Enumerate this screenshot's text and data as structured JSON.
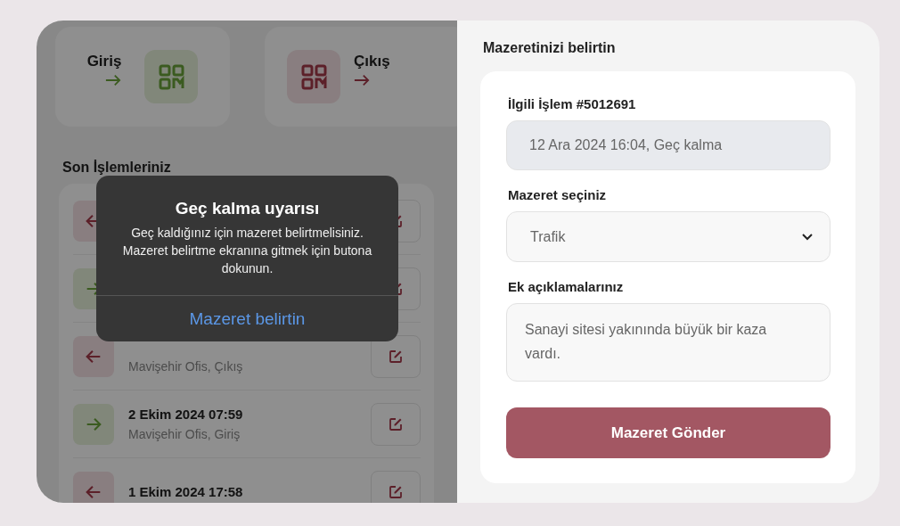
{
  "entry_cards": [
    {
      "label": "Giriş",
      "kind": "in"
    },
    {
      "label": "Çıkış",
      "kind": "out"
    }
  ],
  "recent": {
    "title": "Son İşlemleriniz",
    "rows": [
      {
        "kind": "out"
      },
      {
        "kind": "in"
      },
      {
        "kind": "out",
        "subtitle": "Mavişehir Ofis, Çıkış"
      },
      {
        "kind": "in",
        "title": "2 Ekim 2024 07:59",
        "subtitle": "Mavişehir Ofis, Giriş"
      },
      {
        "kind": "out",
        "title": "1 Ekim 2024 17:58"
      }
    ]
  },
  "alert": {
    "title": "Geç kalma uyarısı",
    "message": "Geç kaldığınız için mazeret belirtmelisiniz. Mazeret belirtme ekranına gitmek için butona dokunun.",
    "action": "Mazeret belirtin"
  },
  "form": {
    "title": "Mazeretinizi belirtin",
    "fields": [
      {
        "kind": "readonly",
        "label": "İlgili İşlem #5012691",
        "value": "12 Ara 2024 16:04, Geç kalma"
      },
      {
        "kind": "select",
        "label": "Mazeret seçiniz",
        "value": "Trafik"
      },
      {
        "kind": "textarea",
        "label": "Ek açıklamalarınız",
        "value": "Sanayi sitesi yakınında büyük bir kaza vardı."
      }
    ],
    "submit": "Mazeret Gönder"
  }
}
